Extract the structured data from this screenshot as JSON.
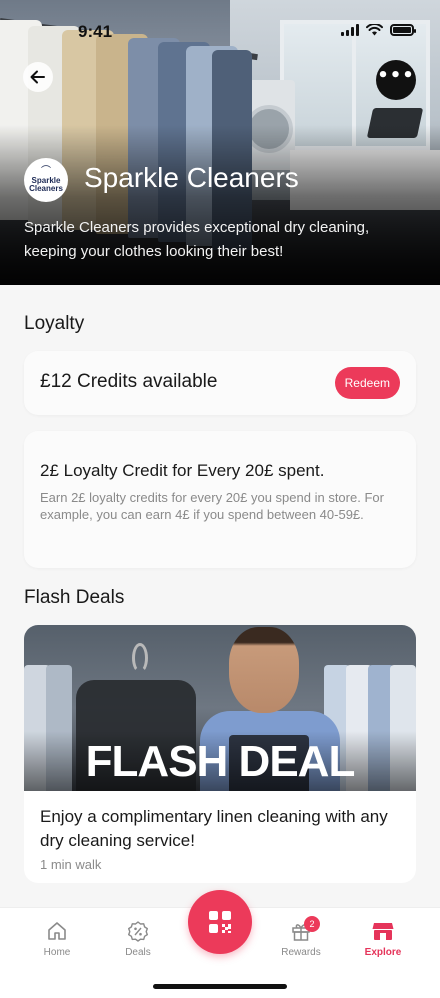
{
  "status_bar": {
    "time": "9:41"
  },
  "store": {
    "logo_text": "Sparkle Cleaners",
    "name": "Sparkle Cleaners",
    "description": "Sparkle Cleaners provides exceptional dry cleaning, keeping your clothes looking their best!"
  },
  "loyalty": {
    "section_title": "Loyalty",
    "credits_text": "£12 Credits available",
    "redeem_label": "Redeem",
    "offer_title": "2£ Loyalty Credit for Every 20£ spent.",
    "offer_description": "Earn 2£ loyalty credits for every 20£ you spend in store. For example, you can earn 4£ if you spend between 40-59£."
  },
  "flash_deals": {
    "section_title": "Flash Deals",
    "deals": [
      {
        "image_label": "FLASH DEAL",
        "title": "Enjoy a complimentary linen cleaning with any dry cleaning service!",
        "distance": "1 min walk"
      }
    ]
  },
  "bottom_nav": {
    "items": [
      {
        "label": "Home",
        "icon": "home-icon"
      },
      {
        "label": "Deals",
        "icon": "discount-badge-icon"
      },
      {
        "label": "",
        "icon": "qr-scan-icon"
      },
      {
        "label": "Rewards",
        "icon": "gift-icon",
        "badge": "2"
      },
      {
        "label": "Explore",
        "icon": "store-icon"
      }
    ]
  },
  "colors": {
    "accent": "#ec3a5a",
    "active_nav": "#e5345a",
    "text_primary": "#1a1a1a",
    "text_secondary": "#8a8a8a"
  }
}
